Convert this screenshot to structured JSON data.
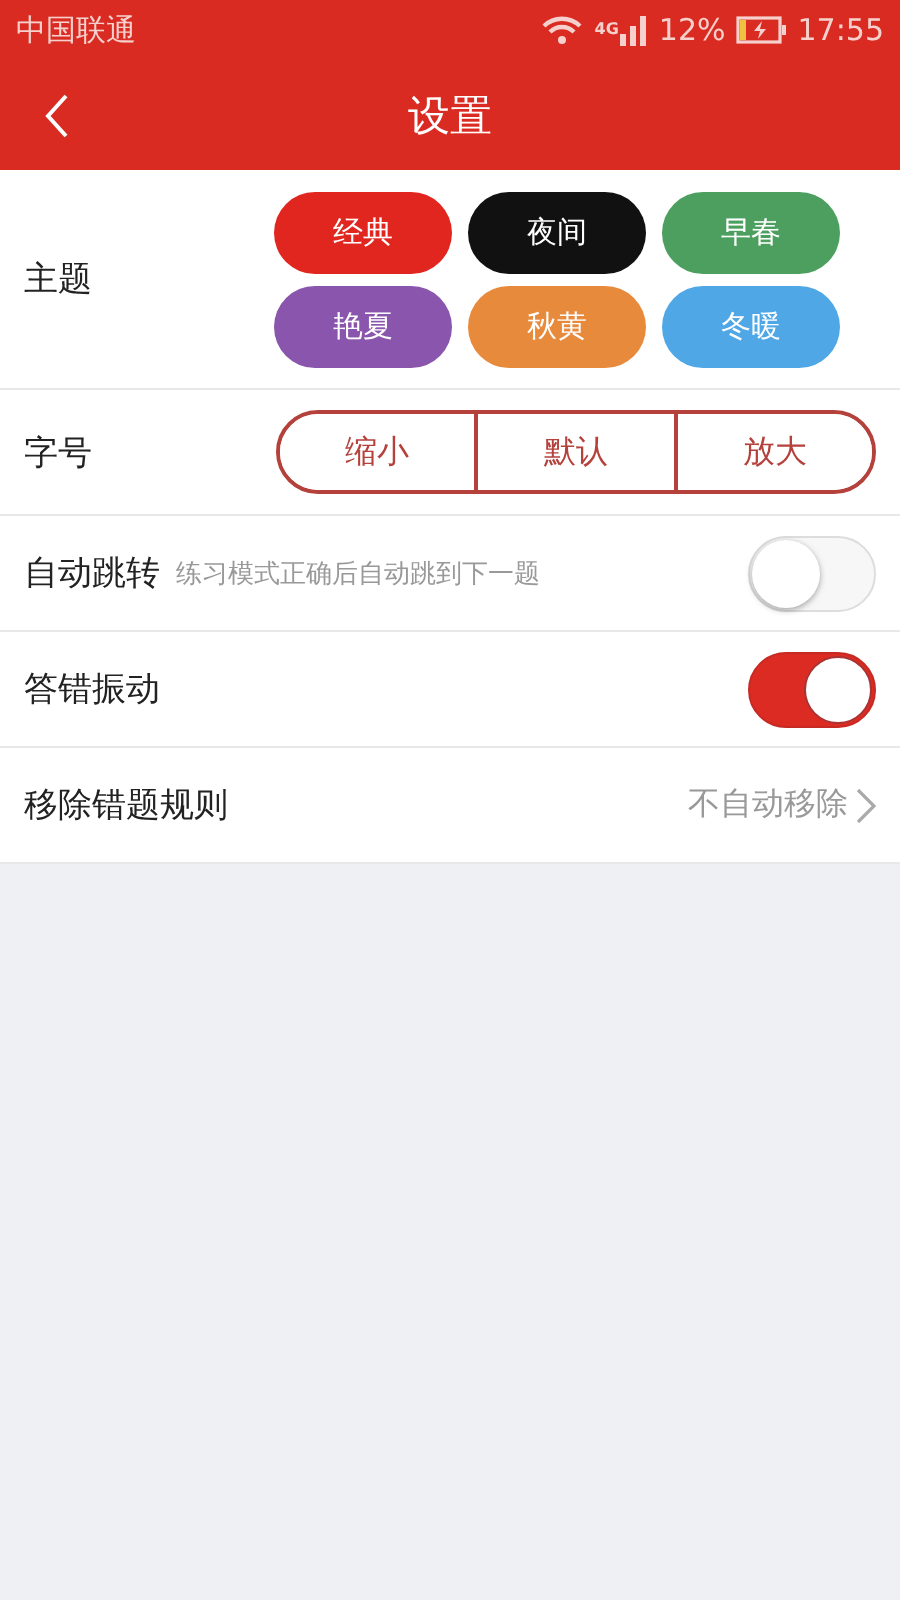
{
  "status_bar": {
    "carrier": "中国联通",
    "network": "4G",
    "battery": "12%",
    "time": "17:55"
  },
  "header": {
    "title": "设置"
  },
  "theme": {
    "label": "主题",
    "options": [
      {
        "label": "经典",
        "color": "#e0261f"
      },
      {
        "label": "夜间",
        "color": "#111111"
      },
      {
        "label": "早春",
        "color": "#4d9f5f"
      },
      {
        "label": "艳夏",
        "color": "#8a55ad"
      },
      {
        "label": "秋黄",
        "color": "#e88a3c"
      },
      {
        "label": "冬暖",
        "color": "#4fa7e6"
      }
    ]
  },
  "font_size": {
    "label": "字号",
    "options": [
      "缩小",
      "默认",
      "放大"
    ]
  },
  "auto_jump": {
    "label": "自动跳转",
    "hint": "练习模式正确后自动跳到下一题",
    "on": false
  },
  "wrong_vibrate": {
    "label": "答错振动",
    "on": true
  },
  "remove_rule": {
    "label": "移除错题规则",
    "value": "不自动移除"
  }
}
